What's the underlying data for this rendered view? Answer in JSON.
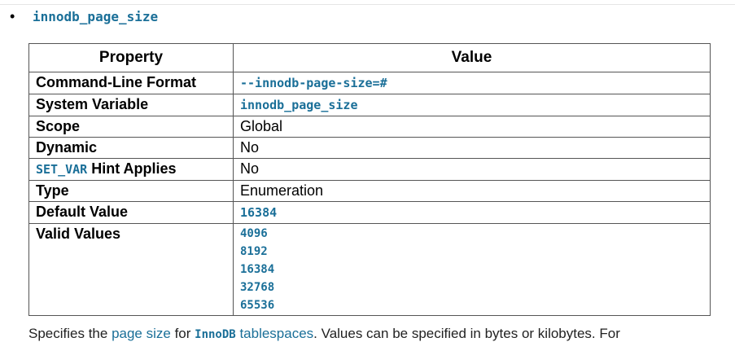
{
  "variable": {
    "name": "innodb_page_size"
  },
  "table": {
    "headers": {
      "property": "Property",
      "value": "Value"
    },
    "rows": {
      "cmd_format": {
        "label": "Command-Line Format",
        "value": "--innodb-page-size=#"
      },
      "sys_var": {
        "label": "System Variable",
        "value": "innodb_page_size"
      },
      "scope": {
        "label": "Scope",
        "value": "Global"
      },
      "dynamic": {
        "label": "Dynamic",
        "value": "No"
      },
      "set_var": {
        "label_code": "SET_VAR",
        "label_rest": " Hint Applies",
        "value": "No"
      },
      "type": {
        "label": "Type",
        "value": "Enumeration"
      },
      "default_value": {
        "label": "Default Value",
        "value": "16384"
      },
      "valid_values": {
        "label": "Valid Values",
        "values": [
          "4096",
          "8192",
          "16384",
          "32768",
          "65536"
        ]
      }
    }
  },
  "description": {
    "part1": "Specifies the ",
    "link1": "page size",
    "part2": " for ",
    "link2_code": "InnoDB",
    "link2_rest": " tablespaces",
    "part3": ". Values can be specified in bytes or kilobytes. For"
  }
}
